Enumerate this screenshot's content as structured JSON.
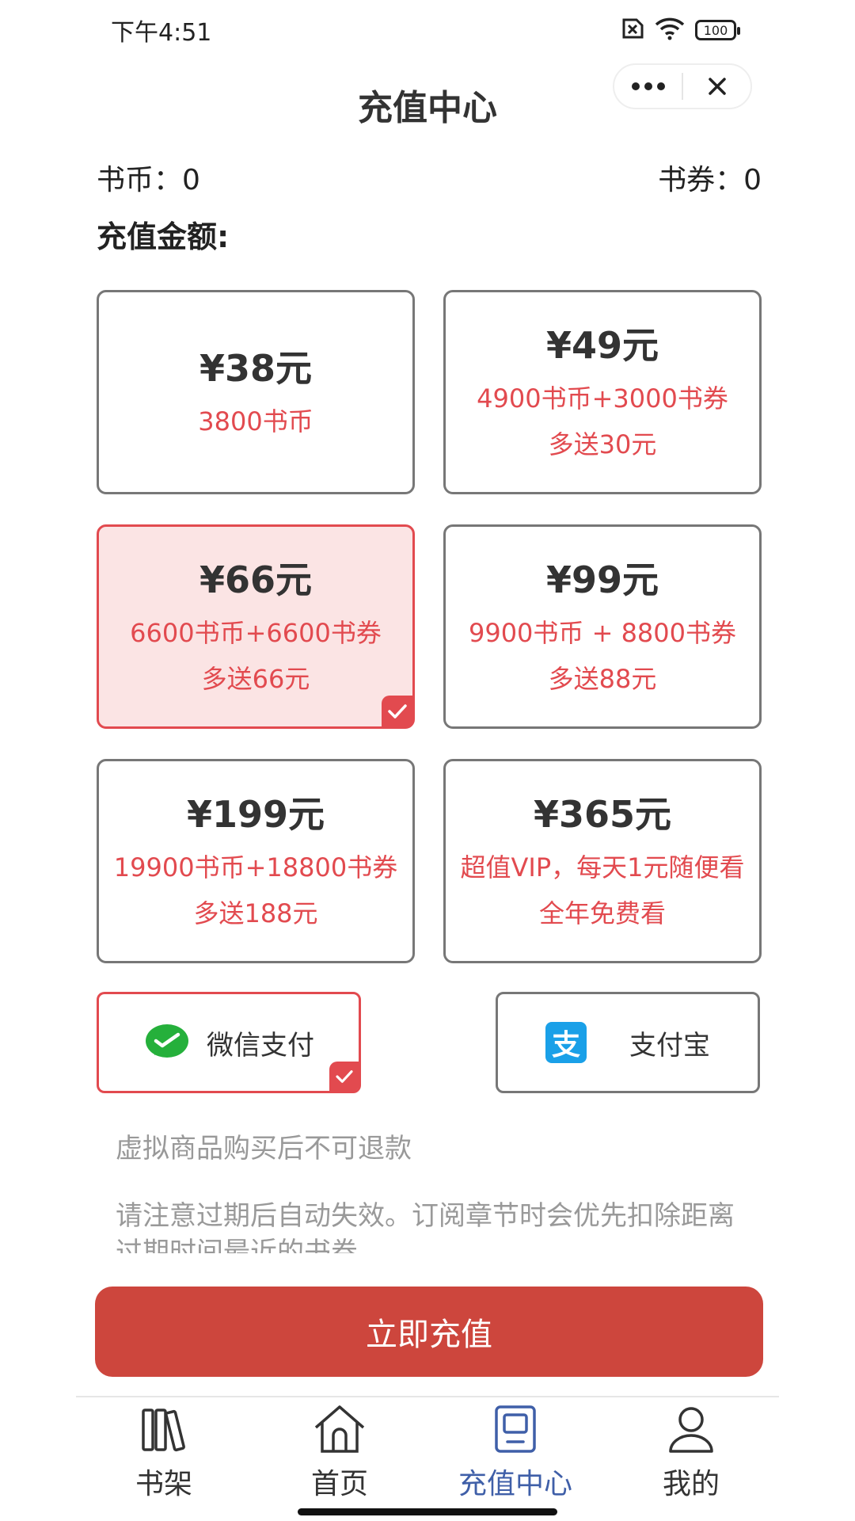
{
  "status": {
    "time": "下午4:51",
    "battery": "100"
  },
  "header": {
    "title": "充值中心"
  },
  "balances": {
    "coins": "书币：0",
    "vouchers": "书券：0"
  },
  "amount_label": "充值金额:",
  "cards": [
    {
      "price": "¥38元",
      "line1": "3800书币",
      "line2": "",
      "selected": false
    },
    {
      "price": "¥49元",
      "line1": "4900书币+3000书券",
      "line2": "多送30元",
      "selected": false
    },
    {
      "price": "¥66元",
      "line1": "6600书币+6600书券",
      "line2": "多送66元",
      "selected": true
    },
    {
      "price": "¥99元",
      "line1": "9900书币 + 8800书券",
      "line2": "多送88元",
      "selected": false
    },
    {
      "price": "¥199元",
      "line1": "19900书币+18800书券",
      "line2": "多送188元",
      "selected": false
    },
    {
      "price": "¥365元",
      "line1": "超值VIP，每天1元随便看",
      "line2": "全年免费看",
      "selected": false
    }
  ],
  "payment": {
    "wechat": "微信支付",
    "alipay": "支付宝",
    "alipay_logo": "支",
    "selected": "wechat"
  },
  "notes": {
    "refund": "虚拟商品购买后不可退款",
    "expiry": "请注意过期后自动失效。订阅章节时会优先扣除距离过期时间最近的书券"
  },
  "cta_label": "立即充值",
  "tabs": [
    {
      "label": "书架",
      "icon": "bookshelf-icon"
    },
    {
      "label": "首页",
      "icon": "home-icon"
    },
    {
      "label": "充值中心",
      "icon": "recharge-icon",
      "active": true
    },
    {
      "label": "我的",
      "icon": "profile-icon"
    }
  ],
  "colors": {
    "accent": "#e24a4f",
    "cta": "#cd463d",
    "tab_active": "#3f5fa8",
    "wechat": "#25b03b",
    "alipay": "#1aa0e8"
  }
}
